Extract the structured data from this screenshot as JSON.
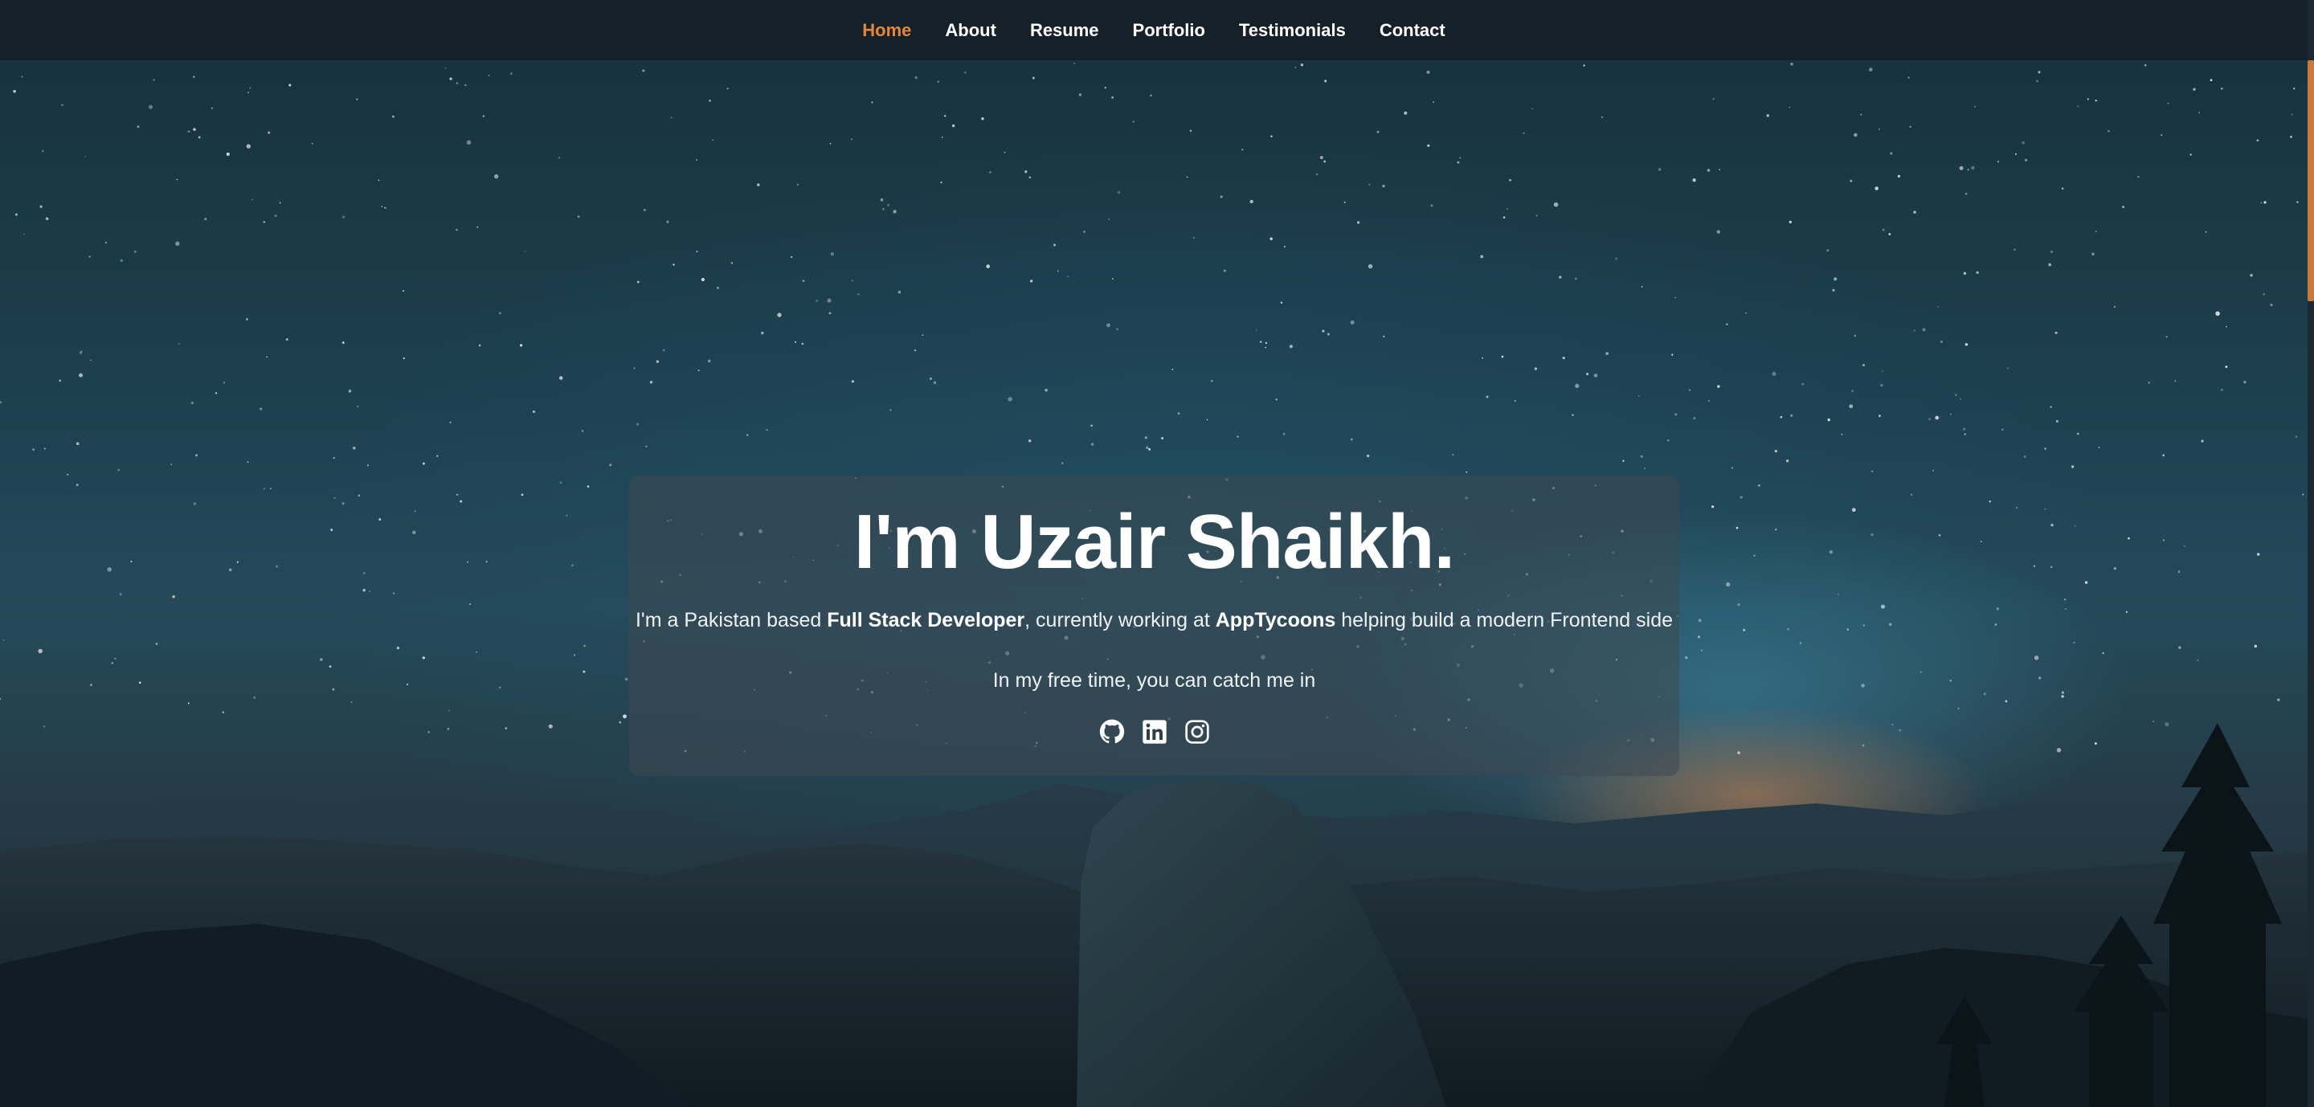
{
  "nav": {
    "items": [
      {
        "label": "Home",
        "active": true
      },
      {
        "label": "About",
        "active": false
      },
      {
        "label": "Resume",
        "active": false
      },
      {
        "label": "Portfolio",
        "active": false
      },
      {
        "label": "Testimonials",
        "active": false
      },
      {
        "label": "Contact",
        "active": false
      }
    ],
    "active_color": "#e5863b"
  },
  "hero": {
    "title": "I'm Uzair Shaikh.",
    "desc_prefix": "I'm a Pakistan based ",
    "role": "Full Stack Developer",
    "desc_middle": ", currently working at ",
    "company": "AppTycoons",
    "desc_suffix": " helping build a modern Frontend side",
    "free_time": "In my free time, you can catch me in",
    "social_icons": [
      "github-icon",
      "linkedin-icon",
      "instagram-icon"
    ]
  },
  "colors": {
    "accent": "#e5863b",
    "navbar_bg": "#152128"
  }
}
